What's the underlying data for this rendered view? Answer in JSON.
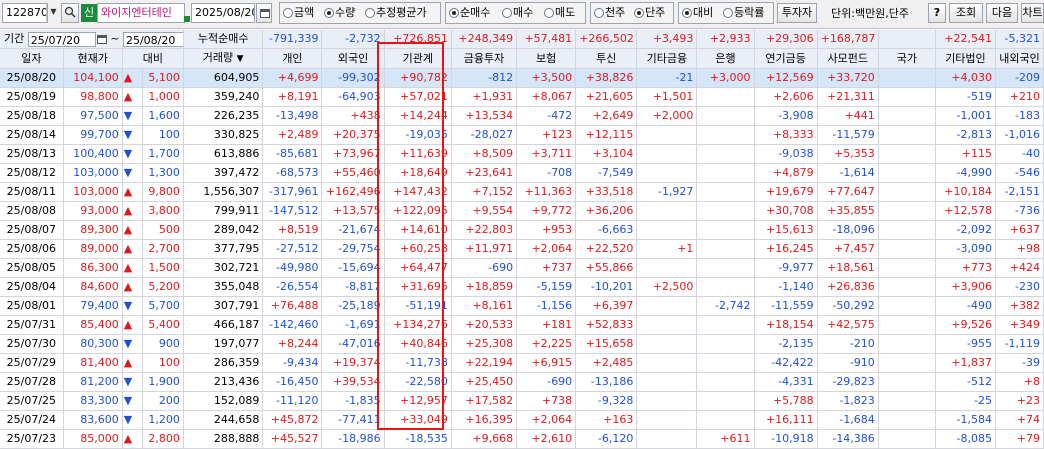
{
  "toolbar": {
    "code": "122870",
    "stock_tag": "신",
    "stock_name": "와이지엔터테인",
    "date": "2025/08/20",
    "radio_group1": [
      {
        "label": "금액",
        "on": false
      },
      {
        "label": "수량",
        "on": true
      },
      {
        "label": "추정평균가",
        "on": false
      }
    ],
    "radio_group2": [
      {
        "label": "순매수",
        "on": true
      },
      {
        "label": "매수",
        "on": false
      },
      {
        "label": "매도",
        "on": false
      }
    ],
    "radio_group3": [
      {
        "label": "천주",
        "on": false
      },
      {
        "label": "단주",
        "on": true
      }
    ],
    "radio_group4": [
      {
        "label": "대비",
        "on": true
      },
      {
        "label": "등락률",
        "on": false
      }
    ],
    "investor_button": "투자자",
    "unit_label": "단위:백만원,단주",
    "help_button": "?",
    "query_button": "조회",
    "next_button": "다음",
    "chart_button": "차트"
  },
  "period": {
    "label": "기간",
    "from": "25/07/20",
    "to": "25/08/20",
    "net_label": "누적순매수",
    "totals": [
      "-791,339",
      "-2,732",
      "+726,851",
      "+248,349",
      "+57,481",
      "+266,502",
      "+3,493",
      "+2,933",
      "+29,306",
      "+168,787",
      "",
      "+22,541",
      "-5,321"
    ]
  },
  "columns": [
    "일자",
    "현재가",
    "대비",
    "거래량",
    "개인",
    "외국인",
    "기관계",
    "금융투자",
    "보험",
    "투신",
    "기타금융",
    "은행",
    "연기금등",
    "사모펀드",
    "국가",
    "기타법인",
    "내외국인"
  ],
  "rows": [
    [
      "25/08/20",
      "104,100",
      "▲",
      "5,100",
      "604,905",
      "+4,699",
      "-99,302",
      "+90,782",
      "-812",
      "+3,500",
      "+38,826",
      "-21",
      "+3,000",
      "+12,569",
      "+33,720",
      "",
      "+4,030",
      "-209"
    ],
    [
      "25/08/19",
      "98,800",
      "▲",
      "1,000",
      "359,240",
      "+8,191",
      "-64,903",
      "+57,021",
      "+1,931",
      "+8,067",
      "+21,605",
      "+1,501",
      "",
      "+2,606",
      "+21,311",
      "",
      "-519",
      "+210"
    ],
    [
      "25/08/18",
      "97,500",
      "▼",
      "1,600",
      "226,235",
      "-13,498",
      "+438",
      "+14,244",
      "+13,534",
      "-472",
      "+2,649",
      "+2,000",
      "",
      "-3,908",
      "+441",
      "",
      "-1,001",
      "-183"
    ],
    [
      "25/08/14",
      "99,700",
      "▼",
      "100",
      "330,825",
      "+2,489",
      "+20,375",
      "-19,035",
      "-28,027",
      "+123",
      "+12,115",
      "",
      "",
      "+8,333",
      "-11,579",
      "",
      "-2,813",
      "-1,016"
    ],
    [
      "25/08/13",
      "100,400",
      "▼",
      "1,700",
      "613,886",
      "-85,681",
      "+73,967",
      "+11,639",
      "+8,509",
      "+3,711",
      "+3,104",
      "",
      "",
      "-9,038",
      "+5,353",
      "",
      "+115",
      "-40"
    ],
    [
      "25/08/12",
      "103,000",
      "▼",
      "1,300",
      "397,472",
      "-68,573",
      "+55,460",
      "+18,649",
      "+23,641",
      "-708",
      "-7,549",
      "",
      "",
      "+4,879",
      "-1,614",
      "",
      "-4,990",
      "-546"
    ],
    [
      "25/08/11",
      "103,000",
      "▲",
      "9,800",
      "1,556,307",
      "-317,961",
      "+162,496",
      "+147,432",
      "+7,152",
      "+11,363",
      "+33,518",
      "-1,927",
      "",
      "+19,679",
      "+77,647",
      "",
      "+10,184",
      "-2,151"
    ],
    [
      "25/08/08",
      "93,000",
      "▲",
      "3,800",
      "799,911",
      "-147,512",
      "+13,575",
      "+122,095",
      "+9,554",
      "+9,772",
      "+36,206",
      "",
      "",
      "+30,708",
      "+35,855",
      "",
      "+12,578",
      "-736"
    ],
    [
      "25/08/07",
      "89,300",
      "▲",
      "500",
      "289,042",
      "+8,519",
      "-21,674",
      "+14,610",
      "+22,803",
      "+953",
      "-6,663",
      "",
      "",
      "+15,613",
      "-18,096",
      "",
      "-2,092",
      "+637"
    ],
    [
      "25/08/06",
      "89,000",
      "▲",
      "2,700",
      "377,795",
      "-27,512",
      "-29,754",
      "+60,258",
      "+11,971",
      "+2,064",
      "+22,520",
      "+1",
      "",
      "+16,245",
      "+7,457",
      "",
      "-3,090",
      "+98"
    ],
    [
      "25/08/05",
      "86,300",
      "▲",
      "1,500",
      "302,721",
      "-49,980",
      "-15,694",
      "+64,477",
      "-690",
      "+737",
      "+55,866",
      "",
      "",
      "-9,977",
      "+18,561",
      "",
      "+773",
      "+424"
    ],
    [
      "25/08/04",
      "84,600",
      "▲",
      "5,200",
      "355,048",
      "-26,554",
      "-8,817",
      "+31,695",
      "+18,859",
      "-5,159",
      "-10,201",
      "+2,500",
      "",
      "-1,140",
      "+26,836",
      "",
      "+3,906",
      "-230"
    ],
    [
      "25/08/01",
      "79,400",
      "▼",
      "5,700",
      "307,791",
      "+76,488",
      "-25,189",
      "-51,191",
      "+8,161",
      "-1,156",
      "+6,397",
      "",
      "-2,742",
      "-11,559",
      "-50,292",
      "",
      "-490",
      "+382"
    ],
    [
      "25/07/31",
      "85,400",
      "▲",
      "5,400",
      "466,187",
      "-142,460",
      "-1,691",
      "+134,276",
      "+20,533",
      "+181",
      "+52,833",
      "",
      "",
      "+18,154",
      "+42,575",
      "",
      "+9,526",
      "+349"
    ],
    [
      "25/07/30",
      "80,300",
      "▼",
      "900",
      "197,077",
      "+8,244",
      "-47,016",
      "+40,846",
      "+25,308",
      "+2,225",
      "+15,658",
      "",
      "",
      "-2,135",
      "-210",
      "",
      "-955",
      "-1,119"
    ],
    [
      "25/07/29",
      "81,400",
      "▲",
      "100",
      "286,359",
      "-9,434",
      "+19,374",
      "-11,738",
      "+22,194",
      "+6,915",
      "+2,485",
      "",
      "",
      "-42,422",
      "-910",
      "",
      "+1,837",
      "-39"
    ],
    [
      "25/07/28",
      "81,200",
      "▼",
      "1,900",
      "213,436",
      "-16,450",
      "+39,534",
      "-22,580",
      "+25,450",
      "-690",
      "-13,186",
      "",
      "",
      "-4,331",
      "-29,823",
      "",
      "-512",
      "+8"
    ],
    [
      "25/07/25",
      "83,300",
      "▼",
      "200",
      "152,089",
      "-11,120",
      "-1,835",
      "+12,957",
      "+17,582",
      "+738",
      "-9,328",
      "",
      "",
      "+5,788",
      "-1,823",
      "",
      "-25",
      "+23"
    ],
    [
      "25/07/24",
      "83,600",
      "▼",
      "1,200",
      "244,658",
      "+45,872",
      "-77,411",
      "+33,049",
      "+16,395",
      "+2,064",
      "+163",
      "",
      "",
      "+16,111",
      "-1,684",
      "",
      "-1,584",
      "+74"
    ],
    [
      "25/07/23",
      "85,000",
      "▲",
      "2,800",
      "288,888",
      "+45,527",
      "-18,986",
      "-18,535",
      "+9,668",
      "+2,610",
      "-6,120",
      "",
      "+611",
      "-10,918",
      "-14,386",
      "",
      "-8,085",
      "+79"
    ]
  ],
  "colors": {
    "up": "#e0191c",
    "down": "#1f50d8",
    "highlight": "#e11111",
    "selected_row": "#d5e6f8"
  }
}
